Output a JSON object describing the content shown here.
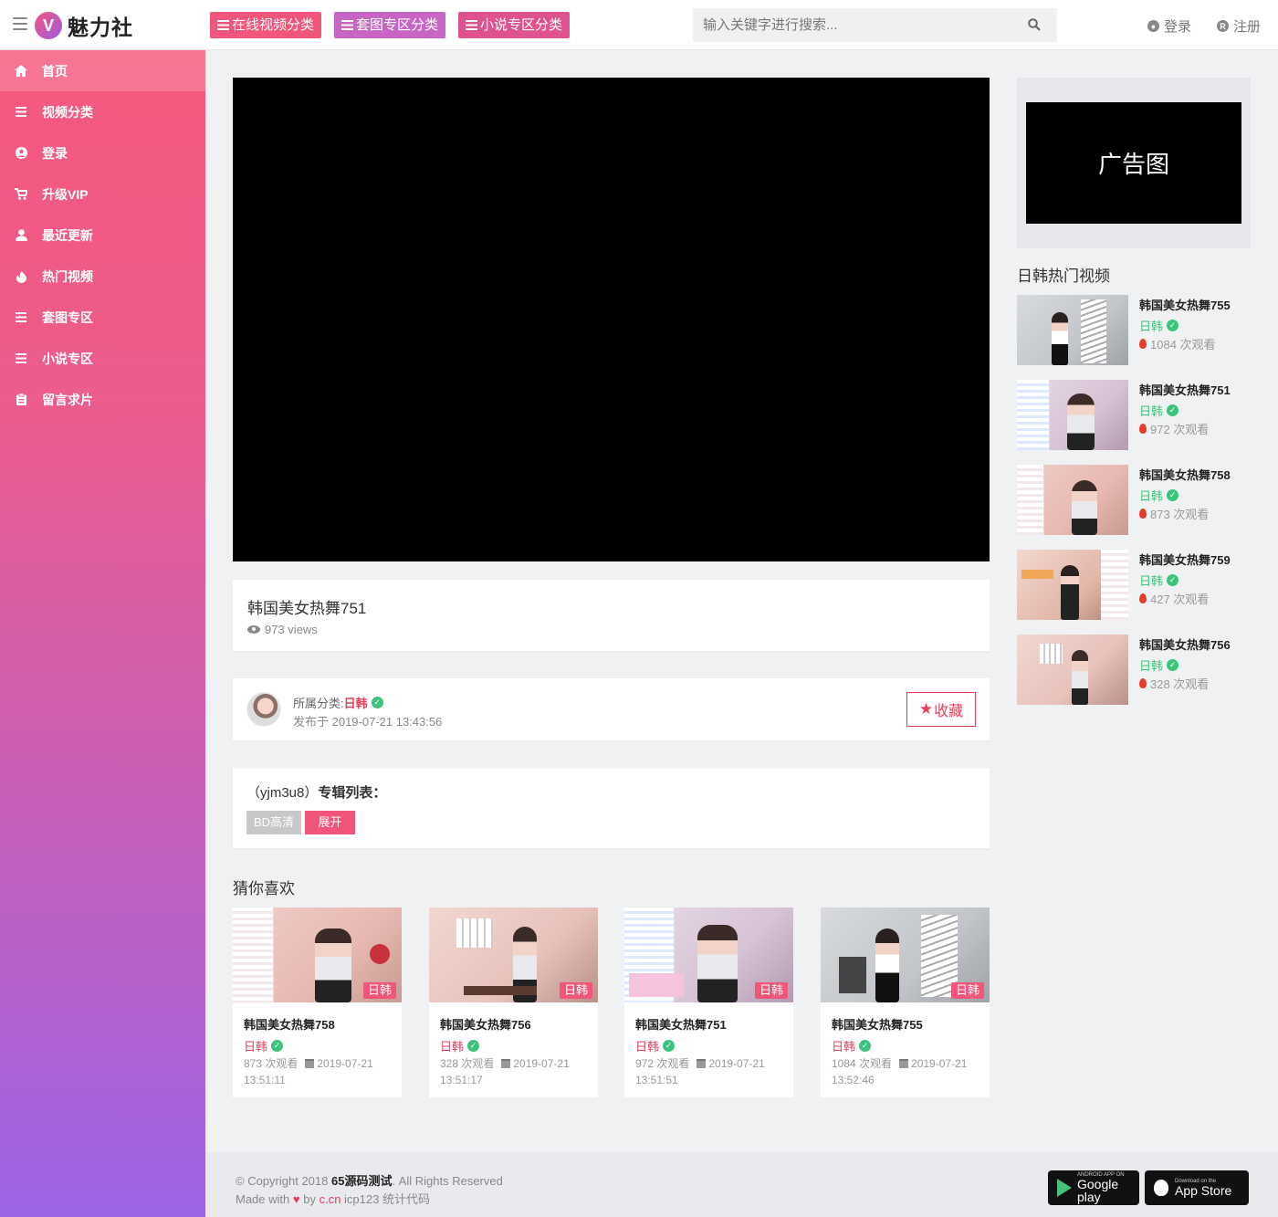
{
  "header": {
    "logo_badge": "V",
    "logo_text": "魅力社",
    "nav_buttons": [
      {
        "label": "在线视频分类",
        "color": "#f0557a"
      },
      {
        "label": "套图专区分类",
        "color": "#c865c4"
      },
      {
        "label": "小说专区分类",
        "color": "#e0528f"
      }
    ],
    "search_placeholder": "输入关键字进行搜索...",
    "login_label": "登录",
    "register_label": "注册"
  },
  "sidebar": {
    "items": [
      {
        "label": "首页",
        "icon": "home-icon"
      },
      {
        "label": "视频分类",
        "icon": "list-icon"
      },
      {
        "label": "登录",
        "icon": "user-circle-icon"
      },
      {
        "label": "升级VIP",
        "icon": "cart-icon"
      },
      {
        "label": "最近更新",
        "icon": "user-icon"
      },
      {
        "label": "热门视频",
        "icon": "fire-icon"
      },
      {
        "label": "套图专区",
        "icon": "list-icon"
      },
      {
        "label": "小说专区",
        "icon": "list-icon"
      },
      {
        "label": "留言求片",
        "icon": "clipboard-icon"
      }
    ]
  },
  "video": {
    "title": "韩国美女热舞751",
    "views": "973 views",
    "category_label": "所属分类:",
    "category": "日韩",
    "published": "发布于 2019-07-21 13:43:56",
    "favorite_label": "收藏"
  },
  "album": {
    "title_prefix": "（yjm3u8）",
    "title_label": "专辑列表：",
    "source_tag": "BD高清",
    "expand_label": "展开"
  },
  "recommend": {
    "heading": "猜你喜欢",
    "items": [
      {
        "title": "韩国美女热舞758",
        "category": "日韩",
        "badge": "日韩",
        "views": "873 次观看",
        "date": "2019-07-21",
        "time": "13:51:11"
      },
      {
        "title": "韩国美女热舞756",
        "category": "日韩",
        "badge": "日韩",
        "views": "328 次观看",
        "date": "2019-07-21",
        "time": "13:51:17"
      },
      {
        "title": "韩国美女热舞751",
        "category": "日韩",
        "badge": "日韩",
        "views": "972 次观看",
        "date": "2019-07-21",
        "time": "13:51:51"
      },
      {
        "title": "韩国美女热舞755",
        "category": "日韩",
        "badge": "日韩",
        "views": "1084 次观看",
        "date": "2019-07-21",
        "time": "13:52:46"
      }
    ]
  },
  "ad": {
    "label": "广告图"
  },
  "hot": {
    "heading": "日韩热门视频",
    "items": [
      {
        "title": "韩国美女热舞755",
        "category": "日韩",
        "views": "1084 次观看"
      },
      {
        "title": "韩国美女热舞751",
        "category": "日韩",
        "views": "972 次观看"
      },
      {
        "title": "韩国美女热舞758",
        "category": "日韩",
        "views": "873 次观看"
      },
      {
        "title": "韩国美女热舞759",
        "category": "日韩",
        "views": "427 次观看"
      },
      {
        "title": "韩国美女热舞756",
        "category": "日韩",
        "views": "328 次观看"
      }
    ]
  },
  "footer": {
    "copyright_prefix": "© Copyright 2018",
    "site_name": "65源码测试",
    "copyright_suffix": ". All Rights Reserved",
    "made_with": "Made with",
    "by": "by",
    "by_link": "c.cn",
    "icp": "icp123 统计代码",
    "google_small": "ANDROID APP ON",
    "google_big": "Google play",
    "apple_small": "Download on the",
    "apple_big": "App Store"
  }
}
